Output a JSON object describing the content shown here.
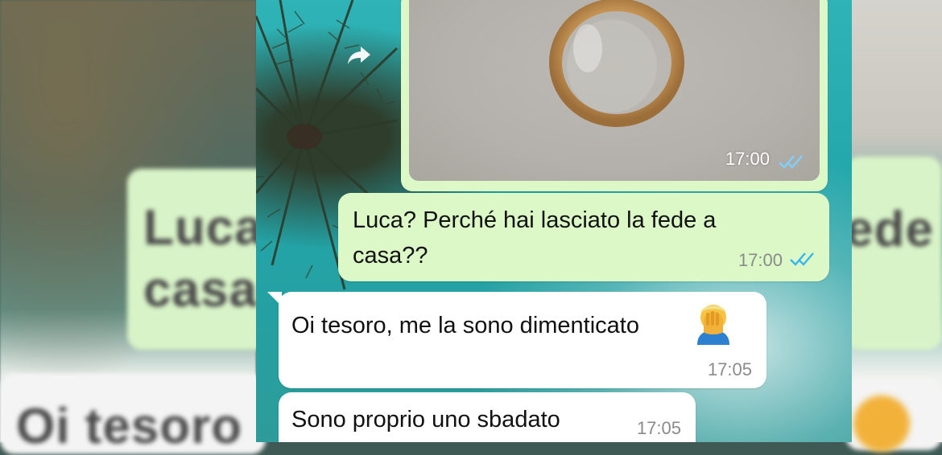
{
  "background": {
    "blurred_left": {
      "line1": "Luca",
      "line2": "casa",
      "line3": "Oi tesoro"
    },
    "blurred_right": {
      "line1": "fede"
    }
  },
  "chat": {
    "photo_message": {
      "time": "17:00",
      "status": "read"
    },
    "messages": [
      {
        "direction": "outgoing",
        "text": "Luca? Perché hai lasciato la fede a casa??",
        "time": "17:00",
        "status": "read"
      },
      {
        "direction": "incoming",
        "text": "Oi tesoro, me la sono dimenticato",
        "emoji": "facepalm",
        "time": "17:05"
      },
      {
        "direction": "incoming",
        "text": "Sono proprio uno sbadato",
        "time": "17:05"
      }
    ]
  },
  "colors": {
    "outgoing_bubble": "#dcf8c6",
    "incoming_bubble": "#ffffff",
    "read_ticks": "#34b7f1",
    "wallpaper": "#24a7aa"
  },
  "icons": [
    "forward-icon",
    "double-check-icon",
    "facepalm-emoji"
  ]
}
